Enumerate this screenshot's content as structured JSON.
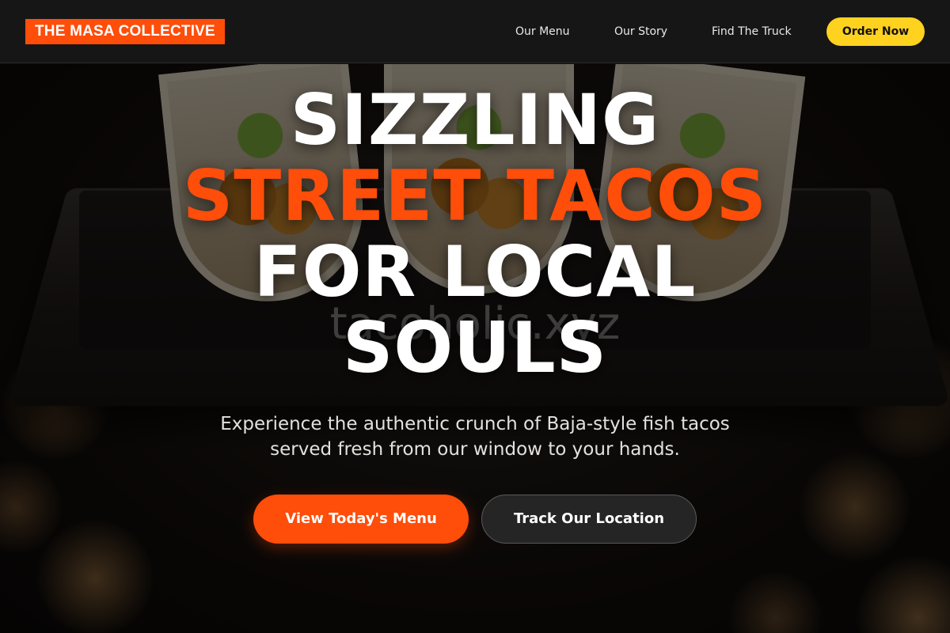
{
  "header": {
    "brand": "THE MASA COLLECTIVE",
    "nav": [
      {
        "label": "Our Menu"
      },
      {
        "label": "Our Story"
      },
      {
        "label": "Find The Truck"
      }
    ],
    "cta_label": "Order Now"
  },
  "hero": {
    "title_line1": "SIZZLING",
    "title_line2": "STREET TACOS",
    "title_line3": "FOR LOCAL",
    "title_line4": "SOULS",
    "watermark": "tacoholic.xyz",
    "subtitle_line1": "Experience the authentic crunch of Baja-style fish tacos",
    "subtitle_line2": "served fresh from our window to your hands.",
    "primary_button": "View Today's Menu",
    "secondary_button": "Track Our Location"
  },
  "colors": {
    "brand_orange": "#ff4d0a",
    "order_yellow": "#ffd21f",
    "header_bg": "#161616"
  }
}
